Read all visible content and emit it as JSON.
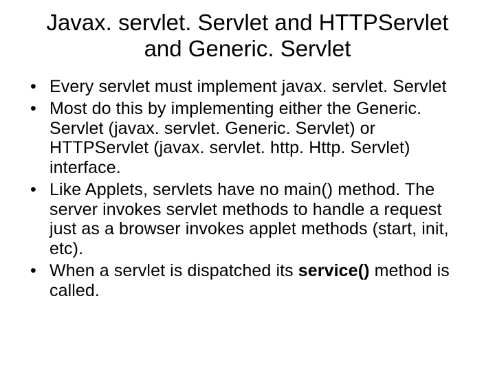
{
  "title": "Javax. servlet. Servlet and HTTPServlet and Generic. Servlet",
  "bullets": [
    {
      "html": "Every servlet must implement javax. servlet. Servlet"
    },
    {
      "html": "Most do this by implementing either the Generic. Servlet (javax. servlet. Generic. Servlet) or HTTPServlet (javax. servlet. http. Http. Servlet) interface."
    },
    {
      "html": "Like Applets, servlets have no main() method. The server invokes servlet methods to handle a request just as a browser invokes applet methods (start, init, etc)."
    },
    {
      "html": "When a servlet is dispatched its <span class=\"bold\">service()</span> method is called."
    }
  ]
}
